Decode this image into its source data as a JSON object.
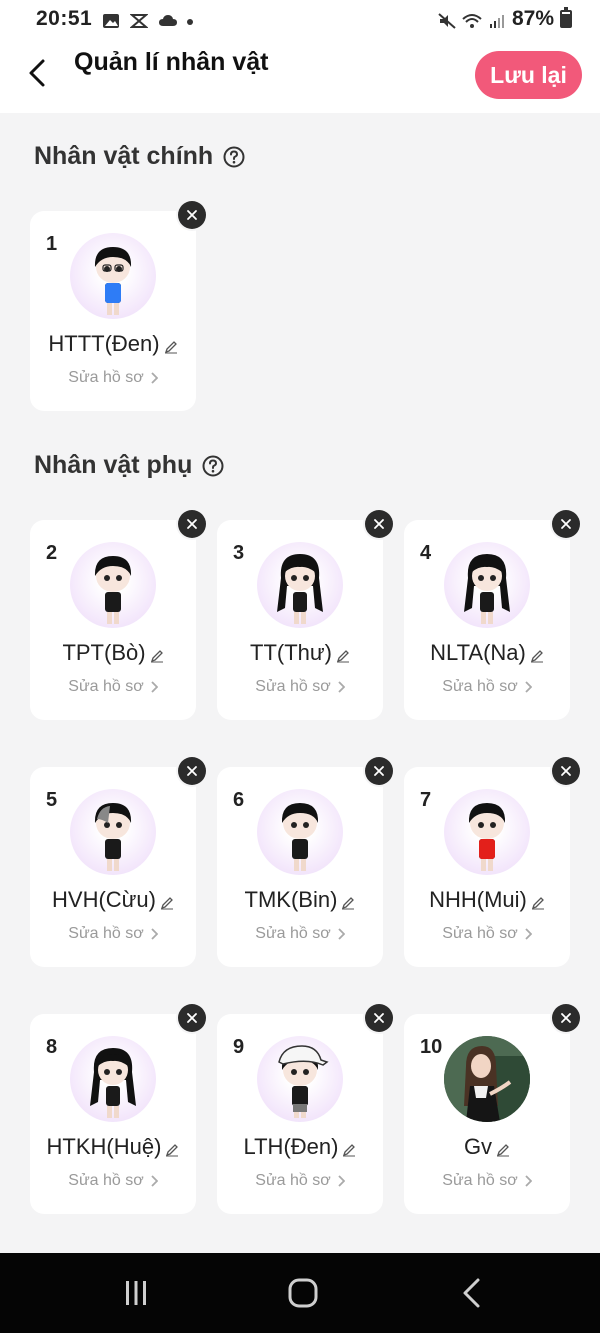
{
  "status_bar": {
    "time": "20:51",
    "battery": "87%",
    "icons": [
      "gallery-icon",
      "app-icon",
      "cloud-icon",
      "dot-icon",
      "mute-icon",
      "wifi-icon",
      "signal-icon",
      "battery-icon"
    ]
  },
  "header": {
    "title": "Quản lí nhân vật",
    "save_label": "Lưu lại",
    "accent_color": "#f2597a"
  },
  "main_section": {
    "title": "Nhân vật chính",
    "characters": [
      {
        "number": "1",
        "name": "HTTT(Đen)",
        "link": "Sửa hồ sơ"
      }
    ]
  },
  "side_section": {
    "title": "Nhân vật phụ",
    "characters": [
      {
        "number": "2",
        "name": "TPT(Bò)",
        "link": "Sửa hồ sơ"
      },
      {
        "number": "3",
        "name": "TT(Thư)",
        "link": "Sửa hồ sơ"
      },
      {
        "number": "4",
        "name": "NLTA(Na)",
        "link": "Sửa hồ sơ"
      },
      {
        "number": "5",
        "name": "HVH(Cừu)",
        "link": "Sửa hồ sơ"
      },
      {
        "number": "6",
        "name": "TMK(Bin)",
        "link": "Sửa hồ sơ"
      },
      {
        "number": "7",
        "name": "NHH(Mui)",
        "link": "Sửa hồ sơ"
      },
      {
        "number": "8",
        "name": "HTKH(Huệ)",
        "link": "Sửa hồ sơ"
      },
      {
        "number": "9",
        "name": "LTH(Đen)",
        "link": "Sửa hồ sơ"
      },
      {
        "number": "10",
        "name": "Gv",
        "link": "Sửa hồ sơ"
      }
    ]
  }
}
